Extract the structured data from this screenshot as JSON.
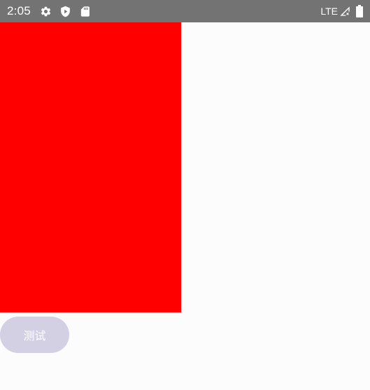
{
  "status_bar": {
    "time": "2:05",
    "left_icons": [
      "gear-icon",
      "shield-play-icon",
      "sd-card-icon"
    ],
    "network": "LTE",
    "right_icons": [
      "signal-no-connection-icon",
      "battery-icon"
    ],
    "background": "#737373"
  },
  "main": {
    "red_block_color": "#ff0000",
    "button": {
      "label": "测试",
      "background": "#d3d0e4"
    }
  }
}
